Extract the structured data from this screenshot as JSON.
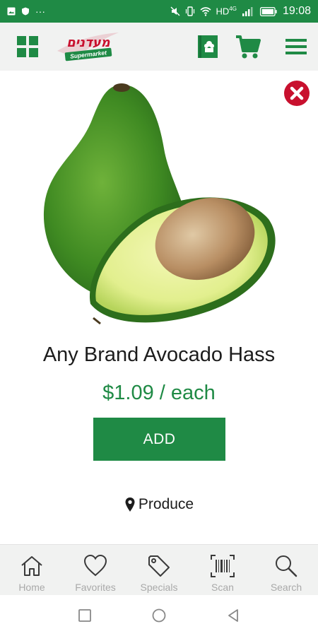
{
  "status_bar": {
    "time": "19:08",
    "network": "HD",
    "network_sup": "4G",
    "overflow": "···"
  },
  "header": {
    "logo_hebrew": "מעדנים",
    "logo_sub": "Supermarket"
  },
  "product": {
    "name": "Any Brand Avocado Hass",
    "price": "$1.09 / each",
    "add_label": "ADD",
    "department": "Produce"
  },
  "bottom_nav": {
    "items": [
      {
        "label": "Home",
        "icon": "home-icon"
      },
      {
        "label": "Favorites",
        "icon": "heart-icon"
      },
      {
        "label": "Specials",
        "icon": "tag-icon"
      },
      {
        "label": "Scan",
        "icon": "barcode-icon"
      },
      {
        "label": "Search",
        "icon": "search-icon"
      }
    ]
  },
  "colors": {
    "brand_green": "#1f8a45",
    "close_red": "#c8102e",
    "nav_label": "#a9a9a9"
  }
}
